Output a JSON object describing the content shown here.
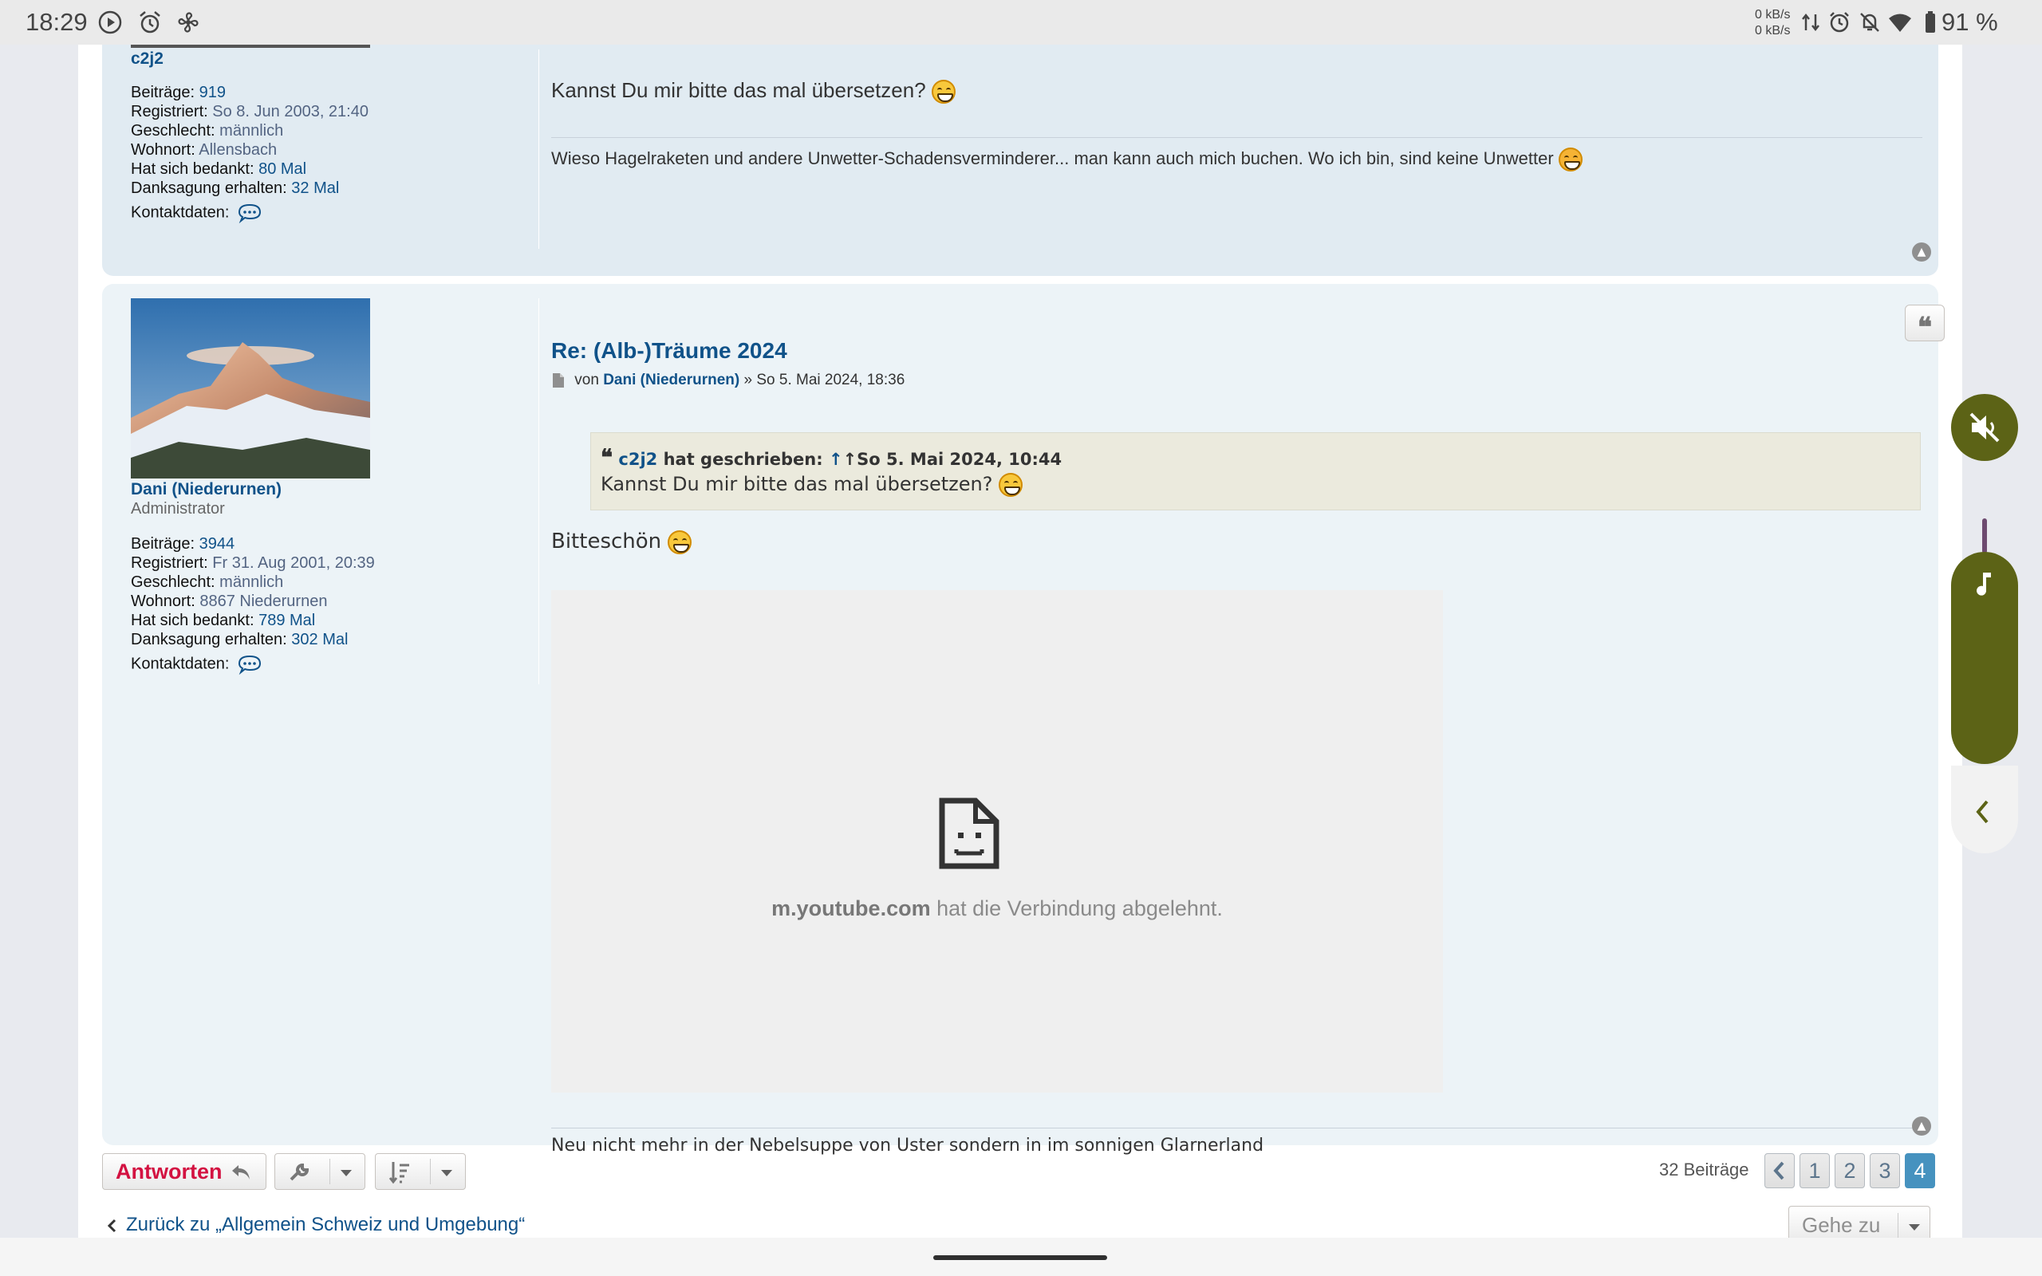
{
  "status_bar": {
    "time": "18:29",
    "net_up": "0 kB/s",
    "net_down": "0 kB/s",
    "battery": "91 %",
    "icons": [
      "play-icon",
      "alarm-icon",
      "fan-icon",
      "data-arrows-icon",
      "alarm-clock-icon",
      "notifications-off-icon",
      "wifi-icon",
      "battery-icon"
    ]
  },
  "post1": {
    "author": "c2j2",
    "profile": [
      {
        "k": "Beiträge:",
        "v": "919"
      },
      {
        "k": "Registriert:",
        "v": "So 8. Jun 2003, 21:40"
      },
      {
        "k": "Geschlecht:",
        "v": "männlich"
      },
      {
        "k": "Wohnort:",
        "v": "Allensbach"
      },
      {
        "k": "Hat sich bedankt:",
        "v": "80 Mal"
      },
      {
        "k": "Danksagung erhalten:",
        "v": "32 Mal"
      }
    ],
    "contact_label": "Kontaktdaten:",
    "text": "Kannst Du mir bitte das mal übersetzen?",
    "signature": "Wieso Hagelraketen und andere Unwetter-Schadensverminderer... man kann auch mich buchen. Wo ich bin, sind keine Unwetter"
  },
  "post2": {
    "author": "Dani (Niederurnen)",
    "rank": "Administrator",
    "profile": [
      {
        "k": "Beiträge:",
        "v": "3944"
      },
      {
        "k": "Registriert:",
        "v": "Fr 31. Aug 2001, 20:39"
      },
      {
        "k": "Geschlecht:",
        "v": "männlich"
      },
      {
        "k": "Wohnort:",
        "v": "8867 Niederurnen"
      },
      {
        "k": "Hat sich bedankt:",
        "v": "789 Mal"
      },
      {
        "k": "Danksagung erhalten:",
        "v": "302 Mal"
      }
    ],
    "contact_label": "Kontaktdaten:",
    "title": "Re: (Alb-)Träume 2024",
    "meta_von": "von",
    "meta_author": "Dani (Niederurnen)",
    "meta_date": "» So 5. Mai 2024, 18:36",
    "quote": {
      "author": "c2j2",
      "wrote": "hat geschrieben:",
      "date": "↑So 5. Mai 2024, 10:44",
      "text": "Kannst Du mir bitte das mal übersetzen?"
    },
    "text": "Bitteschön",
    "embed": {
      "domain": "m.youtube.com",
      "message": "hat die Verbindung abgelehnt."
    },
    "signature": "Neu nicht mehr in der Nebelsuppe von Uster sondern in im sonnigen Glarnerland"
  },
  "actions": {
    "reply_label": "Antworten",
    "post_count": "32 Beiträge",
    "pages": [
      "1",
      "2",
      "3",
      "4"
    ],
    "active_page": "4",
    "back_link": "Zurück zu „Allgemein Schweiz und Umgebung“",
    "jump_label": "Gehe zu"
  }
}
